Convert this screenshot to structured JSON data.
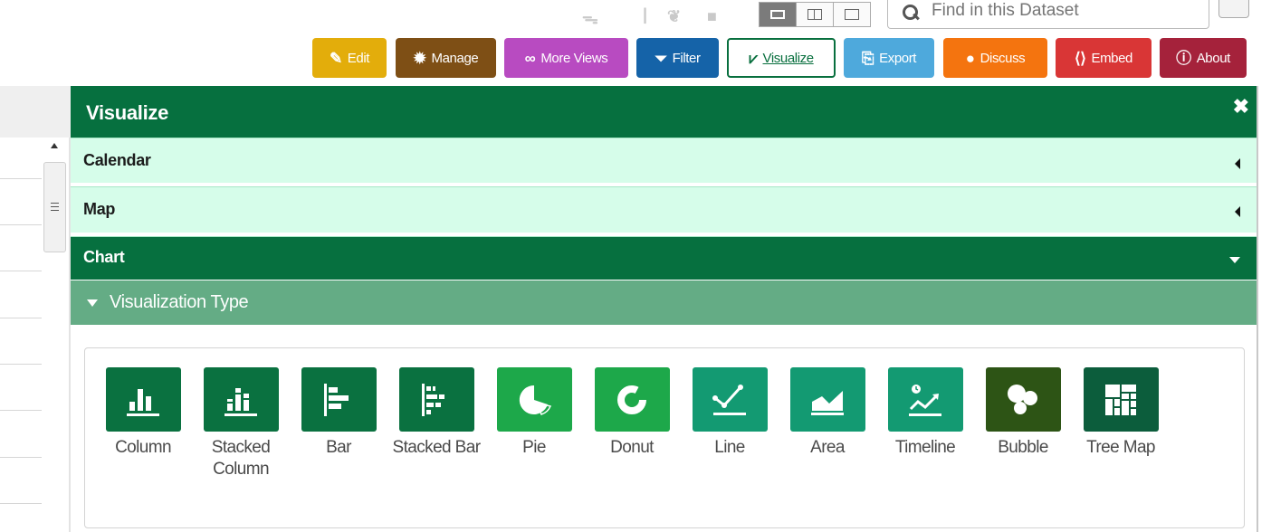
{
  "top": {
    "social_icons": [
      "rss-icon",
      "facebook-icon",
      "twitter-icon",
      "linkedin-icon"
    ],
    "view_toggle": [
      "grid-view-icon",
      "split-view-icon",
      "page-view-icon"
    ],
    "search": {
      "placeholder": "Find in this Dataset"
    }
  },
  "toolbar": {
    "buttons": [
      {
        "label": "Edit",
        "icon": "pencil-icon",
        "color": "#e3ad0b"
      },
      {
        "label": "Manage",
        "icon": "gear-icon",
        "color": "#7e4f15"
      },
      {
        "label": "More Views",
        "icon": "binoculars-icon",
        "color": "#b84bc1"
      },
      {
        "label": "Filter",
        "icon": "funnel-icon",
        "color": "#1563a8"
      },
      {
        "label": "Visualize",
        "icon": "chart-line-icon",
        "color": "#086f3e",
        "active": true
      },
      {
        "label": "Export",
        "icon": "export-icon",
        "color": "#4ea9dc"
      },
      {
        "label": "Discuss",
        "icon": "speech-bubble-icon",
        "color": "#f4740f"
      },
      {
        "label": "Embed",
        "icon": "code-brackets-icon",
        "color": "#d93636"
      },
      {
        "label": "About",
        "icon": "info-icon",
        "color": "#a5223b"
      }
    ]
  },
  "panel": {
    "title": "Visualize",
    "sections": {
      "calendar": "Calendar",
      "map": "Map",
      "chart": "Chart"
    },
    "subsection": "Visualization Type",
    "types": [
      {
        "label": "Column",
        "icon": "column-chart-icon",
        "color": "#0a7140"
      },
      {
        "label": "Stacked Column",
        "icon": "stacked-column-chart-icon",
        "color": "#0a7140"
      },
      {
        "label": "Bar",
        "icon": "bar-chart-icon",
        "color": "#0a7140"
      },
      {
        "label": "Stacked Bar",
        "icon": "stacked-bar-chart-icon",
        "color": "#0a7140"
      },
      {
        "label": "Pie",
        "icon": "pie-chart-icon",
        "color": "#1da84a"
      },
      {
        "label": "Donut",
        "icon": "donut-chart-icon",
        "color": "#1da84a"
      },
      {
        "label": "Line",
        "icon": "line-chart-icon",
        "color": "#139a72"
      },
      {
        "label": "Area",
        "icon": "area-chart-icon",
        "color": "#139a72"
      },
      {
        "label": "Timeline",
        "icon": "timeline-chart-icon",
        "color": "#139a72"
      },
      {
        "label": "Bubble",
        "icon": "bubble-chart-icon",
        "color": "#2d5415"
      },
      {
        "label": "Tree Map",
        "icon": "tree-map-icon",
        "color": "#0c5d3c"
      }
    ]
  }
}
